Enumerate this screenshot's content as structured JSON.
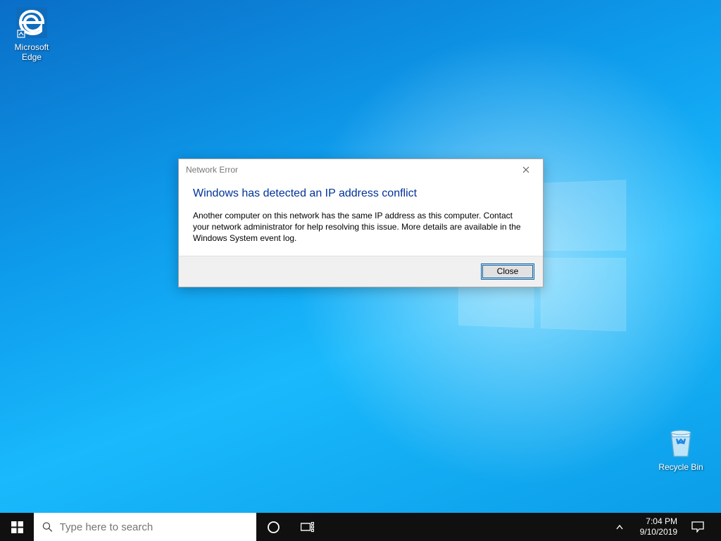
{
  "desktop": {
    "icons": {
      "edge_label": "Microsoft Edge",
      "recycle_label": "Recycle Bin"
    }
  },
  "dialog": {
    "title": "Network Error",
    "heading": "Windows has detected an IP address conflict",
    "message": "Another computer on this network has the same IP address as this computer. Contact your network administrator for help resolving this issue. More details are available in the Windows System event log.",
    "close_button": "Close"
  },
  "taskbar": {
    "search_placeholder": "Type here to search",
    "time": "7:04 PM",
    "date": "9/10/2019"
  }
}
